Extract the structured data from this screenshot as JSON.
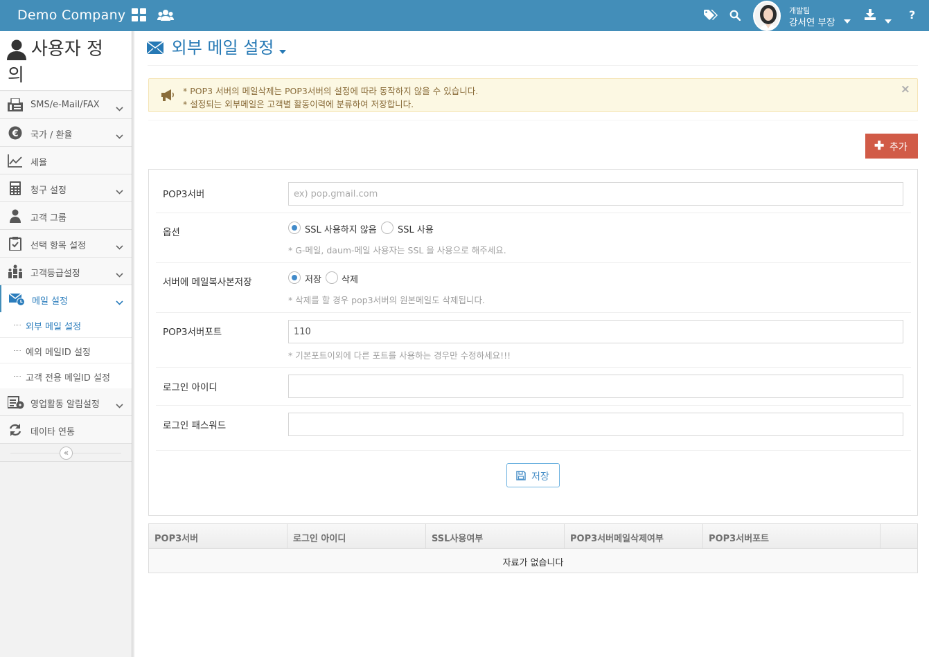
{
  "header": {
    "brand": "Demo Company",
    "user_team": "개발팀",
    "user_name": "강서연 부장"
  },
  "sidebar": {
    "title": "사용자 정의",
    "title_line1": "사용자 정",
    "title_line2": "의",
    "items": [
      {
        "label": "SMS/e-Mail/FAX",
        "icon": "fax-icon",
        "has_submenu": true
      },
      {
        "label": "국가 / 환율",
        "icon": "euro-icon",
        "has_submenu": true
      },
      {
        "label": "세율",
        "icon": "line-chart-icon",
        "has_submenu": false
      },
      {
        "label": "청구 설정",
        "icon": "calculator-icon",
        "has_submenu": true
      },
      {
        "label": "고객 그룹",
        "icon": "user-icon",
        "has_submenu": false
      },
      {
        "label": "선택 항목 설정",
        "icon": "clipboard-check-icon",
        "has_submenu": true
      },
      {
        "label": "고객등급설정",
        "icon": "hierarchy-icon",
        "has_submenu": true
      },
      {
        "label": "메일 설정",
        "icon": "mail-clock-icon",
        "has_submenu": true,
        "active": true
      },
      {
        "label": "영업활동 알림설정",
        "icon": "notification-icon",
        "has_submenu": true
      },
      {
        "label": "데이타 연동",
        "icon": "refresh-icon",
        "has_submenu": false
      }
    ],
    "mail_sub": [
      {
        "label": "외부 메일 설정",
        "active": true
      },
      {
        "label": "예외 메일ID 설정"
      },
      {
        "label": "고객 전용 메일ID 설정"
      }
    ]
  },
  "page": {
    "title": "외부 메일 설정",
    "alert": {
      "line1": "* POP3 서버의 메일삭제는 POP3서버의 설정에 따라 동작하지 않을 수 있습니다.",
      "line2": "* 설정되는 외부메일은 고객별 활동이력에 분류하여 저장합니다."
    },
    "add_label": "추가"
  },
  "form": {
    "pop3_label": "POP3서버",
    "pop3_placeholder": "ex) pop.gmail.com",
    "pop3_value": "",
    "option_label": "옵션",
    "ssl_off_label": "SSL 사용하지 않음",
    "ssl_on_label": "SSL 사용",
    "ssl_selected": "off",
    "ssl_help": "* G-메일, daum-메일 사용자는 SSL 을 사용으로 해주세요.",
    "copy_label": "서버에 메일복사본저장",
    "keep_label": "저장",
    "delete_label": "삭제",
    "copy_selected": "keep",
    "copy_help": "* 삭제를 할 경우 pop3서버의 원본메일도 삭제됩니다.",
    "port_label": "POP3서버포트",
    "port_value": "110",
    "port_help": "* 기본포트이외에 다른 포트를 사용하는 경우만 수정하세요!!!",
    "login_id_label": "로그인 아이디",
    "login_id_value": "",
    "login_pw_label": "로그인 패스워드",
    "login_pw_value": "",
    "save_label": "저장"
  },
  "table": {
    "columns": [
      "POP3서버",
      "로그인 아이디",
      "SSL사용여부",
      "POP3서버메일삭제여부",
      "POP3서버포트",
      ""
    ],
    "empty_text": "자료가 없습니다"
  },
  "colors": {
    "header_bg": "#438eb9",
    "accent": "#2679b5",
    "danger": "#d15b47",
    "alert_bg": "#fcf8e3"
  }
}
